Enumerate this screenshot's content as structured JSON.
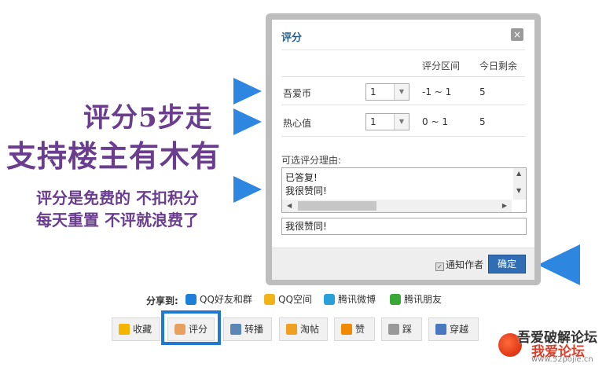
{
  "promo": {
    "line1": "评分5步走",
    "line2": "支持楼主有木有",
    "line3": "评分是免费的 不扣积分",
    "line4": "每天重置 不评就浪费了"
  },
  "dialog": {
    "title": "评分",
    "close_icon": "×",
    "headers": {
      "range": "评分区间",
      "remaining": "今日剩余"
    },
    "rows": [
      {
        "label": "吾爱币",
        "value": "1",
        "range": "-1 ~ 1",
        "remaining": "5"
      },
      {
        "label": "热心值",
        "value": "1",
        "range": "0 ~ 1",
        "remaining": "5"
      }
    ],
    "reason_label": "可选评分理由:",
    "reason_options": [
      "已答复!",
      "我很赞同!"
    ],
    "reason_input_value": "我很赞同!",
    "notify_label": "通知作者",
    "notify_checked": true,
    "confirm_label": "确定"
  },
  "share": {
    "label": "分享到:",
    "items": [
      {
        "label": "QQ好友和群",
        "icon": "qq-icon",
        "color": "#1d7fd8"
      },
      {
        "label": "QQ空间",
        "icon": "qzone-icon",
        "color": "#f2b318"
      },
      {
        "label": "腾讯微博",
        "icon": "tencent-weibo-icon",
        "color": "#2aa0d8"
      },
      {
        "label": "腾讯朋友",
        "icon": "clover-icon",
        "color": "#39a839"
      }
    ]
  },
  "actions": [
    {
      "label": "收藏",
      "icon": "star-icon",
      "color": "#f5b400"
    },
    {
      "label": "评分",
      "icon": "thumbs-up-icon",
      "color": "#e8a060"
    },
    {
      "label": "转播",
      "icon": "share-arrow-icon",
      "color": "#5a86b8"
    },
    {
      "label": "淘帖",
      "icon": "tray-icon",
      "color": "#f0a020"
    },
    {
      "label": "赞",
      "icon": "arrow-up-icon",
      "color": "#f08a00"
    },
    {
      "label": "踩",
      "icon": "arrow-down-icon",
      "color": "#999999"
    },
    {
      "label": "穿越",
      "icon": "paper-plane-icon",
      "color": "#4a78c0"
    }
  ],
  "watermark": {
    "line1": "吾爱破解论坛",
    "line2": "我爱论坛",
    "line3": "www.52pojie.cn"
  },
  "colors": {
    "accent": "#2d86e0",
    "promo": "#6a3d8f",
    "confirm": "#2f6db5"
  }
}
